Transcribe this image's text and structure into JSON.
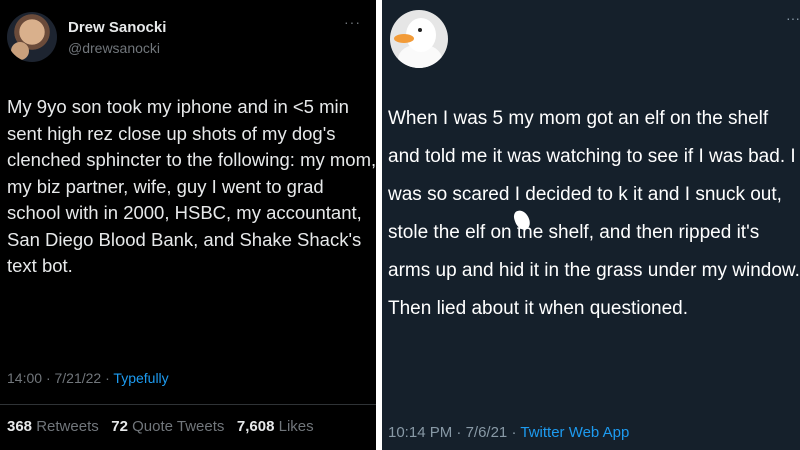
{
  "left_tweet": {
    "display_name": "Drew Sanocki",
    "handle": "@drewsanocki",
    "more": "···",
    "text": "My 9yo son took my iphone and in <5 min sent high rez close up shots of my dog's clenched sphincter to the following: my mom, my biz partner, wife, guy I went to grad school with in 2000, HSBC, my accountant, San Diego Blood Bank, and Shake Shack's text bot.",
    "time": "14:00",
    "date": "7/21/22",
    "source": "Typefully",
    "retweets": "368",
    "retweets_label": "Retweets",
    "quote_tweets": "72",
    "quote_tweets_label": "Quote Tweets",
    "likes": "7,608",
    "likes_label": "Likes"
  },
  "right_tweet": {
    "more": "···",
    "text": "When I was 5 my mom got an elf on the shelf and told me it was watching to see if I was bad. I was so scared I decided to k   it and I snuck out, stole the elf on the shelf, and then ripped it's arms up and hid it in the grass under my window. Then lied about it when questioned.",
    "time": "10:14 PM",
    "date": "7/6/21",
    "source": "Twitter Web App"
  },
  "colors": {
    "left_bg": "#000000",
    "right_bg": "#15202b",
    "link_blue": "#1d9bf0",
    "muted_gray": "#71767b"
  }
}
